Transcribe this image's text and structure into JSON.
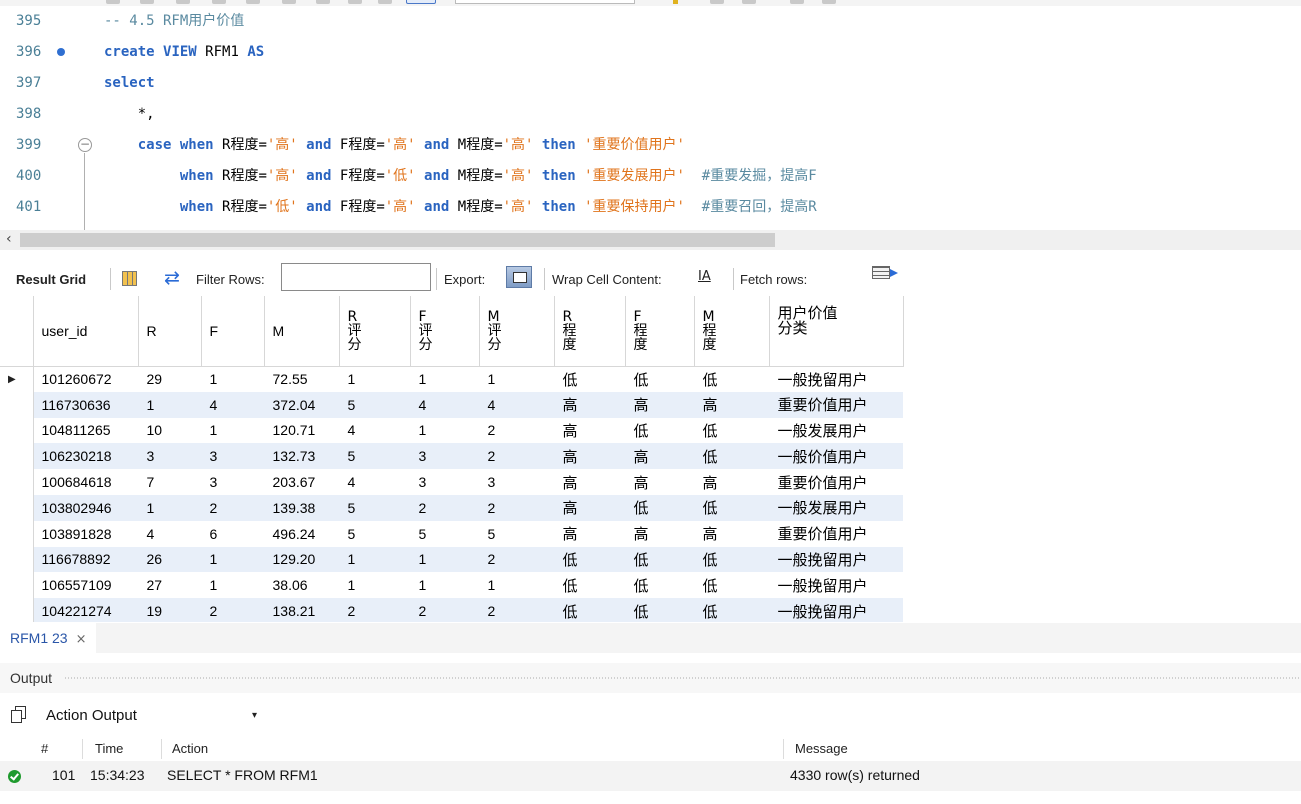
{
  "editor": {
    "lines": [
      {
        "num": "395",
        "parts": [
          {
            "t": "-- 4.5 RFM用户价值",
            "c": "cm"
          }
        ]
      },
      {
        "num": "396",
        "breakpoint": true,
        "parts": [
          {
            "t": "create ",
            "c": "kw"
          },
          {
            "t": "VIEW ",
            "c": "kw"
          },
          {
            "t": "RFM1 ",
            "c": "tx"
          },
          {
            "t": "AS",
            "c": "kw"
          }
        ]
      },
      {
        "num": "397",
        "parts": [
          {
            "t": "select",
            "c": "kw"
          }
        ]
      },
      {
        "num": "398",
        "parts": [
          {
            "t": "    *,",
            "c": "tx"
          }
        ]
      },
      {
        "num": "399",
        "fold": true,
        "parts": [
          {
            "t": "    case when ",
            "c": "kw"
          },
          {
            "t": "R程度=",
            "c": "tx"
          },
          {
            "t": "'高'",
            "c": "st"
          },
          {
            "t": " and ",
            "c": "kw"
          },
          {
            "t": "F程度=",
            "c": "tx"
          },
          {
            "t": "'高'",
            "c": "st"
          },
          {
            "t": " and ",
            "c": "kw"
          },
          {
            "t": "M程度=",
            "c": "tx"
          },
          {
            "t": "'高'",
            "c": "st"
          },
          {
            "t": " then ",
            "c": "kw"
          },
          {
            "t": "'重要价值用户'",
            "c": "st"
          }
        ]
      },
      {
        "num": "400",
        "parts": [
          {
            "t": "         when ",
            "c": "kw"
          },
          {
            "t": "R程度=",
            "c": "tx"
          },
          {
            "t": "'高'",
            "c": "st"
          },
          {
            "t": " and ",
            "c": "kw"
          },
          {
            "t": "F程度=",
            "c": "tx"
          },
          {
            "t": "'低'",
            "c": "st"
          },
          {
            "t": " and ",
            "c": "kw"
          },
          {
            "t": "M程度=",
            "c": "tx"
          },
          {
            "t": "'高'",
            "c": "st"
          },
          {
            "t": " then ",
            "c": "kw"
          },
          {
            "t": "'重要发展用户'",
            "c": "st"
          },
          {
            "t": "  #重要发掘，提高F",
            "c": "cm"
          }
        ]
      },
      {
        "num": "401",
        "parts": [
          {
            "t": "         when ",
            "c": "kw"
          },
          {
            "t": "R程度=",
            "c": "tx"
          },
          {
            "t": "'低'",
            "c": "st"
          },
          {
            "t": " and ",
            "c": "kw"
          },
          {
            "t": "F程度=",
            "c": "tx"
          },
          {
            "t": "'高'",
            "c": "st"
          },
          {
            "t": " and ",
            "c": "kw"
          },
          {
            "t": "M程度=",
            "c": "tx"
          },
          {
            "t": "'高'",
            "c": "st"
          },
          {
            "t": " then ",
            "c": "kw"
          },
          {
            "t": "'重要保持用户'",
            "c": "st"
          },
          {
            "t": "  #重要召回，提高R",
            "c": "cm"
          }
        ]
      }
    ]
  },
  "hscroll": {
    "arrow": "‹"
  },
  "result_toolbar": {
    "result_grid_label": "Result Grid",
    "filter_rows_label": "Filter Rows:",
    "filter_value": "",
    "export_label": "Export:",
    "wrap_label": "Wrap Cell Content:",
    "wrap_icon_text": "IA",
    "fetch_label": "Fetch rows:"
  },
  "grid": {
    "row_marker": "▶",
    "columns": [
      {
        "label": "user_id",
        "stack": false
      },
      {
        "label": "R",
        "stack": false
      },
      {
        "label": "F",
        "stack": false
      },
      {
        "label": "M",
        "stack": false
      },
      {
        "label": "R评分",
        "stack": true
      },
      {
        "label": "F评分",
        "stack": true
      },
      {
        "label": "M评分",
        "stack": true
      },
      {
        "label": "R程度",
        "stack": true
      },
      {
        "label": "F程度",
        "stack": true
      },
      {
        "label": "M程度",
        "stack": true
      },
      {
        "label": "用户价值分类",
        "stack": "two"
      }
    ],
    "rows": [
      [
        "101260672",
        "29",
        "1",
        "72.55",
        "1",
        "1",
        "1",
        "低",
        "低",
        "低",
        "一般挽留用户"
      ],
      [
        "116730636",
        "1",
        "4",
        "372.04",
        "5",
        "4",
        "4",
        "高",
        "高",
        "高",
        "重要价值用户"
      ],
      [
        "104811265",
        "10",
        "1",
        "120.71",
        "4",
        "1",
        "2",
        "高",
        "低",
        "低",
        "一般发展用户"
      ],
      [
        "106230218",
        "3",
        "3",
        "132.73",
        "5",
        "3",
        "2",
        "高",
        "高",
        "低",
        "一般价值用户"
      ],
      [
        "100684618",
        "7",
        "3",
        "203.67",
        "4",
        "3",
        "3",
        "高",
        "高",
        "高",
        "重要价值用户"
      ],
      [
        "103802946",
        "1",
        "2",
        "139.38",
        "5",
        "2",
        "2",
        "高",
        "低",
        "低",
        "一般发展用户"
      ],
      [
        "103891828",
        "4",
        "6",
        "496.24",
        "5",
        "5",
        "5",
        "高",
        "高",
        "高",
        "重要价值用户"
      ],
      [
        "116678892",
        "26",
        "1",
        "129.20",
        "1",
        "1",
        "2",
        "低",
        "低",
        "低",
        "一般挽留用户"
      ],
      [
        "106557109",
        "27",
        "1",
        "38.06",
        "1",
        "1",
        "1",
        "低",
        "低",
        "低",
        "一般挽留用户"
      ],
      [
        "104221274",
        "19",
        "2",
        "138.21",
        "2",
        "2",
        "2",
        "低",
        "低",
        "低",
        "一般挽留用户"
      ]
    ]
  },
  "result_tab": {
    "label": "RFM1 23",
    "close": "×"
  },
  "output": {
    "title": "Output",
    "selector_value": "Action Output",
    "dropdown_glyph": "▾",
    "columns": {
      "num": "#",
      "time": "Time",
      "action": "Action",
      "message": "Message"
    },
    "rows": [
      {
        "num": "101",
        "time": "15:34:23",
        "action": "SELECT * FROM RFM1",
        "message": "4330 row(s) returned"
      }
    ]
  }
}
